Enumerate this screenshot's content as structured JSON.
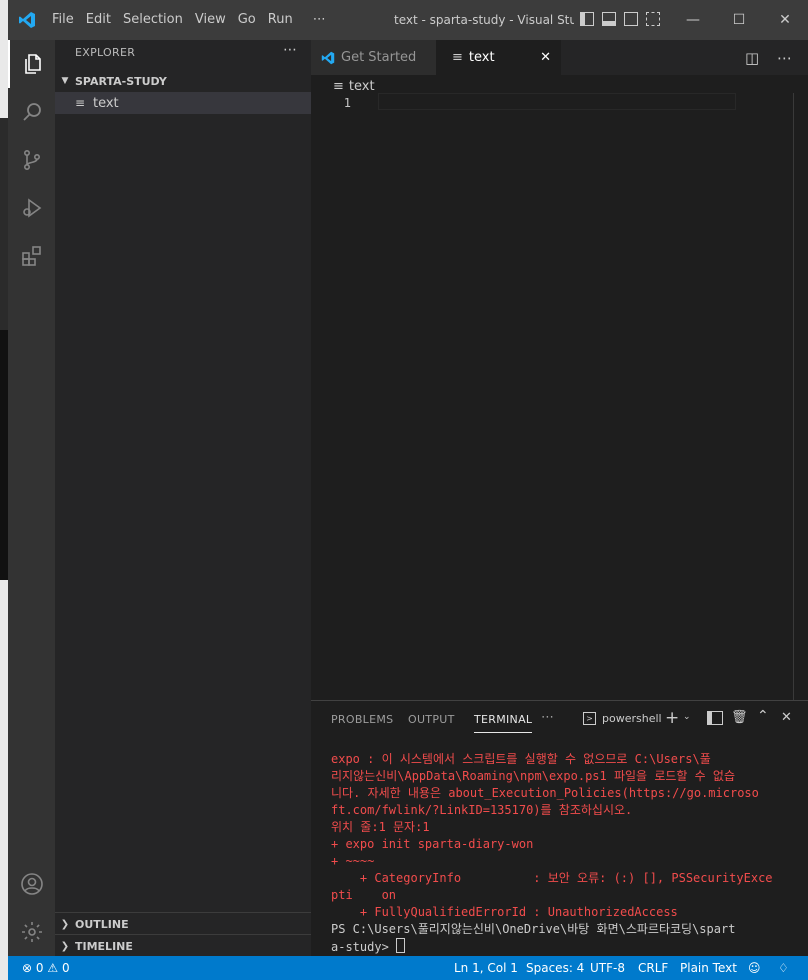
{
  "window": {
    "title": "text - sparta-study - Visual Studi..."
  },
  "menu": [
    "File",
    "Edit",
    "Selection",
    "View",
    "Go",
    "Run",
    "⋯"
  ],
  "sidebar": {
    "title": "EXPLORER",
    "more": "⋯",
    "folder": "SPARTA-STUDY",
    "file": "text",
    "outline": "OUTLINE",
    "timeline": "TIMELINE"
  },
  "tabs": [
    {
      "label": "Get Started",
      "active": false
    },
    {
      "label": "text",
      "active": true
    }
  ],
  "editor": {
    "breadcrumb": "text",
    "line_number": "1"
  },
  "panel": {
    "tabs": [
      "PROBLEMS",
      "OUTPUT",
      "TERMINAL",
      "⋯"
    ],
    "active_tab": "TERMINAL",
    "shell": "powershell",
    "terminal_lines": [
      {
        "text": "expo : 이 시스템에서 스크립트를 실행할 수 없으므로 C:\\Users\\풀",
        "kind": "err"
      },
      {
        "text": "리지않는신비\\AppData\\Roaming\\npm\\expo.ps1 파일을 로드할 수 없습",
        "kind": "err"
      },
      {
        "text": "니다. 자세한 내용은 about_Execution_Policies(https://go.microso",
        "kind": "err"
      },
      {
        "text": "ft.com/fwlink/?LinkID=135170)를 참조하십시오.",
        "kind": "err"
      },
      {
        "text": "위치 줄:1 문자:1",
        "kind": "err"
      },
      {
        "text": "+ expo init sparta-diary-won",
        "kind": "err"
      },
      {
        "text": "+ ~~~~",
        "kind": "err"
      },
      {
        "text": "    + CategoryInfo          : 보안 오류: (:) [], PSSecurityExce",
        "kind": "err"
      },
      {
        "text": "pti    on",
        "kind": "err"
      },
      {
        "text": "    + FullyQualifiedErrorId : UnauthorizedAccess",
        "kind": "err"
      },
      {
        "text": "PS C:\\Users\\풀리지않는신비\\OneDrive\\바탕 화면\\스파르타코딩\\spart",
        "kind": "ok"
      },
      {
        "text": "a-study> ",
        "kind": "ok"
      }
    ]
  },
  "status": {
    "errors": "0",
    "warnings": "0",
    "position": "Ln 1, Col 1",
    "spaces": "Spaces: 4",
    "encoding": "UTF-8",
    "eol": "CRLF",
    "language": "Plain Text"
  },
  "colors": {
    "accent": "#007acc",
    "error_text": "#f14c4c",
    "logo": "#23a9f2"
  }
}
